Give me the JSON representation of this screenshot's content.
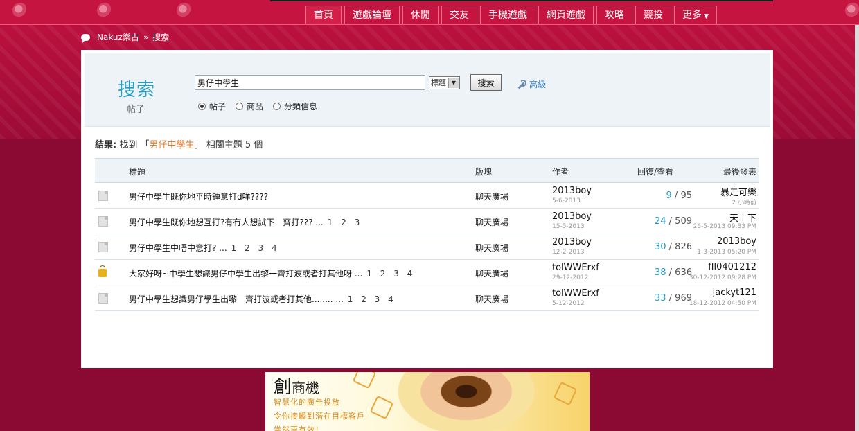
{
  "nav": {
    "items": [
      "首頁",
      "遊戲論壇",
      "休閒",
      "交友",
      "手機遊戲",
      "網頁遊戲",
      "攻略",
      "競投",
      "更多"
    ],
    "more_caret": "▼"
  },
  "breadcrumb": {
    "site": "Nakuz樂古",
    "sep": "»",
    "current": "搜索"
  },
  "search": {
    "title": "搜索",
    "subtitle": "帖子",
    "query": "男仔中學生",
    "select_value": "標題",
    "button_label": "搜索",
    "advanced_label": "高級",
    "radios": [
      {
        "label": "帖子",
        "checked": true
      },
      {
        "label": "商品",
        "checked": false
      },
      {
        "label": "分類信息",
        "checked": false
      }
    ]
  },
  "result": {
    "label": "結果:",
    "pre": "找到",
    "lq": "「",
    "keyword": "男仔中學生",
    "rq": "」",
    "post": "相關主題",
    "count": "5",
    "unit": "個"
  },
  "table": {
    "headers": {
      "subject": "標題",
      "forum": "版塊",
      "author": "作者",
      "counts": "回復/查看",
      "last": "最後發表"
    },
    "rows": [
      {
        "icon": "doc-icon",
        "subject": "男仔中學生既你地平時鍾意打d咩????",
        "pages": "",
        "forum": "聊天廣場",
        "author": "2013boy",
        "author_date": "5-6-2013",
        "replies": "9",
        "views": "95",
        "last_poster": "暴走可樂",
        "last_date": "2 小時前"
      },
      {
        "icon": "doc-icon",
        "subject": "男仔中學生既你地想互打?有冇人想試下一齊打??? ...",
        "pages": "1 2 3",
        "forum": "聊天廣場",
        "author": "2013boy",
        "author_date": "15-5-2013",
        "replies": "24",
        "views": "509",
        "last_poster": "天丨下",
        "last_date": "26-5-2013 09:33 PM"
      },
      {
        "icon": "doc-icon",
        "subject": "男仔中學生中唔中意打? ...",
        "pages": "1 2 3 4",
        "forum": "聊天廣場",
        "author": "2013boy",
        "author_date": "12-2-2013",
        "replies": "30",
        "views": "826",
        "last_poster": "2013boy",
        "last_date": "1-3-2013 05:20 PM"
      },
      {
        "icon": "lock-icon",
        "subject": "大家好呀~中學生想識男仔中學生出黎一齊打波或者打其他呀 ...",
        "pages": "1 2 3 4",
        "forum": "聊天廣場",
        "author": "tolWWErxf",
        "author_date": "29-12-2012",
        "replies": "38",
        "views": "636",
        "last_poster": "fll0401212",
        "last_date": "30-12-2012 09:28 PM"
      },
      {
        "icon": "doc-icon",
        "subject": "男仔中學生想識男仔學生出嚟一齊打波或者打其他........ ...",
        "pages": "1 2 3 4",
        "forum": "聊天廣場",
        "author": "tolWWErxf",
        "author_date": "5-12-2012",
        "replies": "33",
        "views": "969",
        "last_poster": "jackyt121",
        "last_date": "18-12-2012 04:50 PM"
      }
    ],
    "sep": "/"
  },
  "ad": {
    "title_big": "創",
    "title_rest": "商機",
    "line1": "智慧化的廣告投放",
    "line2": "令你接觸到潛在目標客戶",
    "line3": "當然更有效！"
  }
}
